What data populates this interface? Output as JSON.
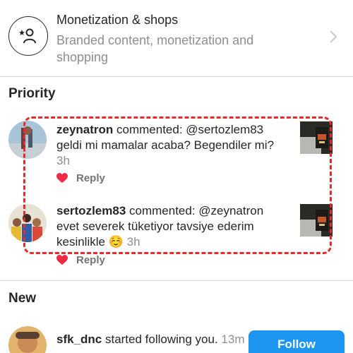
{
  "monetization": {
    "title": "Monetization & shops",
    "subtitle": "Branded content, monetization and shopping",
    "icon": "person-star-icon"
  },
  "sections": {
    "priority": "Priority",
    "new": "New"
  },
  "priority_items": [
    {
      "username": "zeynatron",
      "action": " commented: @sertozlem83 geldi mi mamalar acaba? Begendiler mi?",
      "time": "3h",
      "reply_label": "Reply"
    },
    {
      "username": "sertozlem83",
      "action": " commented: @zeynatron evet severek tüketiyor tavsiye ederim kesinlikle ☺️",
      "time": "3h",
      "reply_label": "Reply"
    }
  ],
  "new_items": [
    {
      "username": "sfk_dnc",
      "action": " started following you.",
      "time": "13m",
      "button_label": "Follow"
    }
  ],
  "colors": {
    "accent": "#1c96f0",
    "like_heart": "#ed2b46",
    "highlight": "#e52b2b"
  }
}
